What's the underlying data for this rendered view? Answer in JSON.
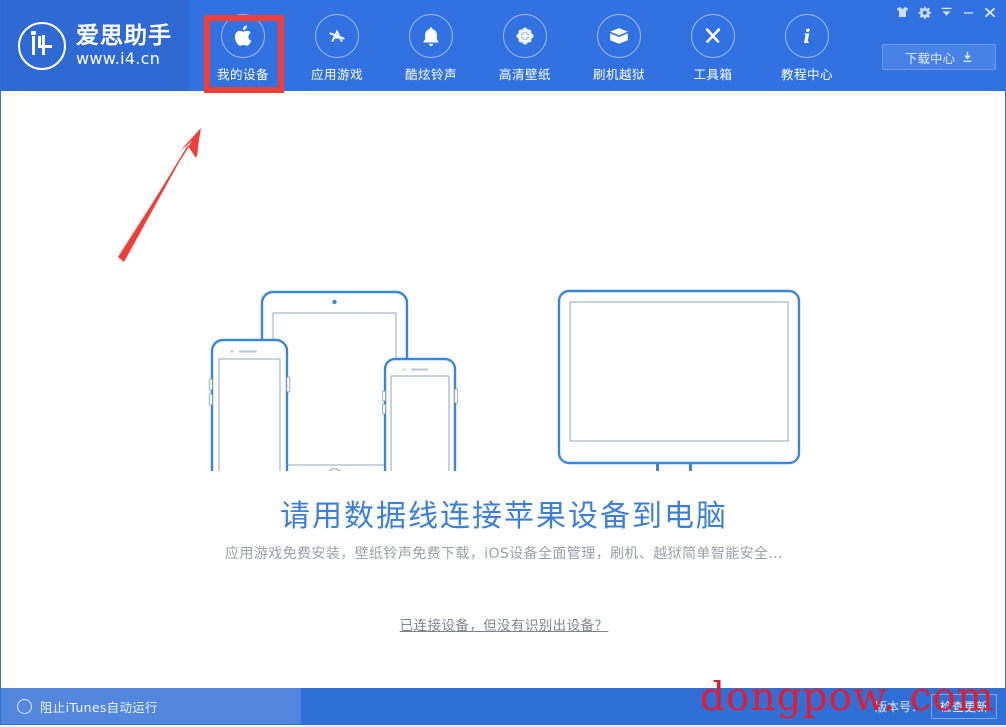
{
  "window": {
    "controls": [
      {
        "name": "skin-icon",
        "label": "皮肤",
        "glyph": "tshirt"
      },
      {
        "name": "settings-icon",
        "label": "设置",
        "glyph": "gear"
      },
      {
        "name": "minimize-to-tray-icon",
        "label": "最小化到托盘",
        "glyph": "tray"
      },
      {
        "name": "minimize-icon",
        "label": "最小化",
        "glyph": "minus"
      },
      {
        "name": "close-icon",
        "label": "关闭",
        "glyph": "close"
      }
    ]
  },
  "header": {
    "brand_cn": "爱思助手",
    "brand_url": "www.i4.cn",
    "background": "#3171e0",
    "tabs": [
      {
        "label": "我的设备",
        "icon": "apple-icon",
        "active": true
      },
      {
        "label": "应用游戏",
        "icon": "appstore-icon",
        "active": false
      },
      {
        "label": "酷炫铃声",
        "icon": "bell-icon",
        "active": false
      },
      {
        "label": "高清壁纸",
        "icon": "flower-icon",
        "active": false
      },
      {
        "label": "刷机越狱",
        "icon": "box-icon",
        "active": false
      },
      {
        "label": "工具箱",
        "icon": "tools-icon",
        "active": false
      },
      {
        "label": "教程中心",
        "icon": "info-icon",
        "active": false
      }
    ],
    "download_center": "下载中心"
  },
  "main": {
    "headline": "请用数据线连接苹果设备到电脑",
    "subline": "应用游戏免费安装，壁纸铃声免费下载，iOS设备全面管理，刷机、越狱简单智能安全...",
    "help_link": "已连接设备，但没有识别出设备？",
    "illustration": {
      "devices": [
        "iphone-large",
        "ipad",
        "iphone-small"
      ],
      "monitor": "desktop-monitor",
      "cable": "usb-lightning-cable",
      "line_color": "#3d85d6"
    }
  },
  "statusbar": {
    "itunes_toggle_label": "阻止iTunes自动运行",
    "itunes_toggle_checked": false,
    "version_label": "版本号：",
    "update_button": "检查更新",
    "background": "#2f6fd6"
  },
  "annotations": {
    "highlight_box_color": "#ef3f38",
    "arrow_color": "#ef3f38",
    "arrow_target": "我的设备"
  },
  "watermark": {
    "text": "dongpow. com",
    "color": "#e8192a"
  }
}
